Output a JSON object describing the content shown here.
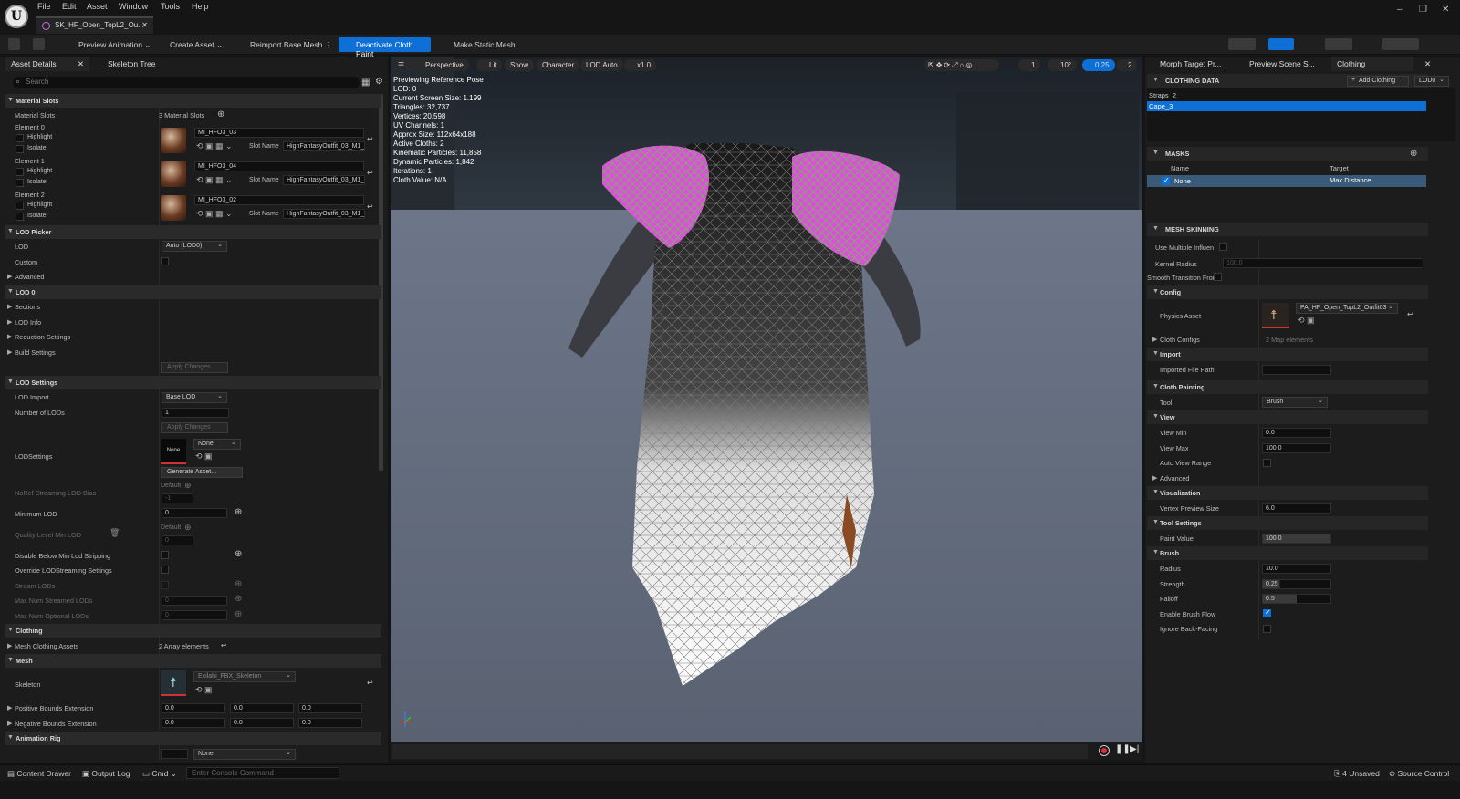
{
  "menu": [
    "File",
    "Edit",
    "Asset",
    "Window",
    "Tools",
    "Help"
  ],
  "asset_tab": "SK_HF_Open_TopL2_Ou...",
  "window_controls": [
    "–",
    "❐",
    "✕"
  ],
  "toolbar": {
    "preview_animation": "Preview Animation",
    "create_asset": "Create Asset",
    "reimport": "Reimport Base Mesh",
    "deactivate": "Deactivate Cloth Paint",
    "make_static": "Make Static Mesh"
  },
  "left_tabs": {
    "asset_details": "Asset Details",
    "skeleton_tree": "Skeleton Tree",
    "close": "✕"
  },
  "search_placeholder": "Search",
  "material": {
    "cat": "Material Slots",
    "label": "Material Slots",
    "count": "3 Material Slots",
    "elements": [
      {
        "name": "Element 0",
        "mat": "MI_HFO3_03",
        "slot": "HighFantasyOutfit_03_M1_I"
      },
      {
        "name": "Element 1",
        "mat": "MI_HFO3_04",
        "slot": "HighFantasyOutfit_03_M1_I"
      },
      {
        "name": "Element 2",
        "mat": "MI_HFO3_02",
        "slot": "HighFantasyOutfit_03_M1_I"
      }
    ],
    "highlight": "Highlight",
    "isolate": "Isolate",
    "slot_name": "Slot Name"
  },
  "lod_picker": {
    "cat": "LOD Picker",
    "lod": "LOD",
    "lod_value": "Auto (LOD0)",
    "custom": "Custom",
    "advanced": "Advanced"
  },
  "lod0": {
    "cat": "LOD 0",
    "sections": "Sections",
    "lod_info": "LOD Info",
    "reduction": "Reduction Settings",
    "build": "Build Settings",
    "apply": "Apply Changes"
  },
  "lod_settings": {
    "cat": "LOD Settings",
    "lod_import": "LOD Import",
    "lod_import_value": "Base LOD",
    "num_lods": "Number of LODs",
    "num_lods_value": "1",
    "apply": "Apply Changes",
    "lodsettings": "LODSettings",
    "none_thumb": "None",
    "none_dd": "None",
    "generate": "Generate Asset...",
    "noref": "NoRef Streaming LOD Bias",
    "default": "Default",
    "noref_value": "-1",
    "min_lod": "Minimum LOD",
    "min_lod_value": "0",
    "quality": "Quality Level Min LOD",
    "quality_value": "0",
    "disable_below": "Disable Below Min Lod Stripping",
    "override": "Override LODStreaming Settings",
    "stream_lods": "Stream LODs",
    "max_streamed": "Max Num Streamed LODs",
    "max_streamed_value": "0",
    "max_optional": "Max Num Optional LODs",
    "max_optional_value": "0"
  },
  "clothing": {
    "cat": "Clothing",
    "assets": "Mesh Clothing Assets",
    "assets_value": "2 Array elements"
  },
  "mesh": {
    "cat": "Mesh",
    "skeleton": "Skeleton",
    "skeleton_value": "Exilahi_FBX_Skeleton",
    "pos_bounds": "Positive Bounds Extension",
    "neg_bounds": "Negative Bounds Extension",
    "pos_values": [
      "0.0",
      "0.0",
      "0.0"
    ],
    "neg_values": [
      "0.0",
      "0.0",
      "0.0"
    ]
  },
  "anim_rig": {
    "cat": "Animation Rig",
    "value": "None"
  },
  "viewport": {
    "perspective": "Perspective",
    "lit": "Lit",
    "show": "Show",
    "character": "Character",
    "lod_auto": "LOD Auto",
    "speed": "x1.0",
    "grid": "1",
    "angle": "10°",
    "scale": "0.25",
    "cam": "2"
  },
  "stats": [
    "Previewing Reference Pose",
    "LOD: 0",
    "Current Screen Size: 1.199",
    "Triangles: 32,737",
    "Vertices: 20,598",
    "UV Channels: 1",
    "Approx Size: 112x64x188",
    "Active Cloths: 2",
    "Kinematic Particles: 11,858",
    "Dynamic Particles: 1,842",
    "Iterations: 1",
    "Cloth Value: N/A"
  ],
  "right_tabs": {
    "morph": "Morph Target Pr...",
    "preview": "Preview Scene S...",
    "clothing": "Clothing",
    "close": "✕"
  },
  "clothing_data": {
    "cat": "CLOTHING DATA",
    "add": "Add Clothing",
    "lod": "LOD0",
    "items": [
      "Straps_2",
      "Cape_3"
    ]
  },
  "masks": {
    "cat": "MASKS",
    "name_col": "Name",
    "target_col": "Target",
    "row_name": "None",
    "row_target": "Max Distance"
  },
  "skinning": {
    "cat": "MESH SKINNING",
    "multi": "Use Multiple Influen",
    "kernel": "Kernel Radius",
    "kernel_value": "100.0",
    "smooth": "Smooth Transition Fror"
  },
  "config": {
    "cat": "Config",
    "physics": "Physics Asset",
    "physics_value": "PA_HF_Open_TopL2_Outfit03",
    "cloth_configs": "Cloth Configs",
    "cloth_configs_value": "2 Map elements"
  },
  "import": {
    "cat": "Import",
    "path": "Imported File Path"
  },
  "painting": {
    "cat": "Cloth Painting",
    "tool": "Tool",
    "tool_value": "Brush"
  },
  "view": {
    "cat": "View",
    "min": "View Min",
    "min_value": "0.0",
    "max": "View Max",
    "max_value": "100.0",
    "auto": "Auto View Range",
    "advanced": "Advanced"
  },
  "visualization": {
    "cat": "Visualization",
    "size": "Vertex Preview Size",
    "size_value": "6.0"
  },
  "tool_settings": {
    "cat": "Tool Settings",
    "paint": "Paint Value",
    "paint_value": "100.0"
  },
  "brush": {
    "cat": "Brush",
    "radius": "Radius",
    "radius_value": "10.0",
    "strength": "Strength",
    "strength_value": "0.25",
    "falloff": "Falloff",
    "falloff_value": "0.5",
    "flow": "Enable Brush Flow",
    "backface": "Ignore Back-Facing"
  },
  "statusbar": {
    "content": "Content Drawer",
    "output": "Output Log",
    "cmd": "Cmd",
    "console": "Enter Console Command",
    "unsaved": "4 Unsaved",
    "source": "Source Control"
  }
}
